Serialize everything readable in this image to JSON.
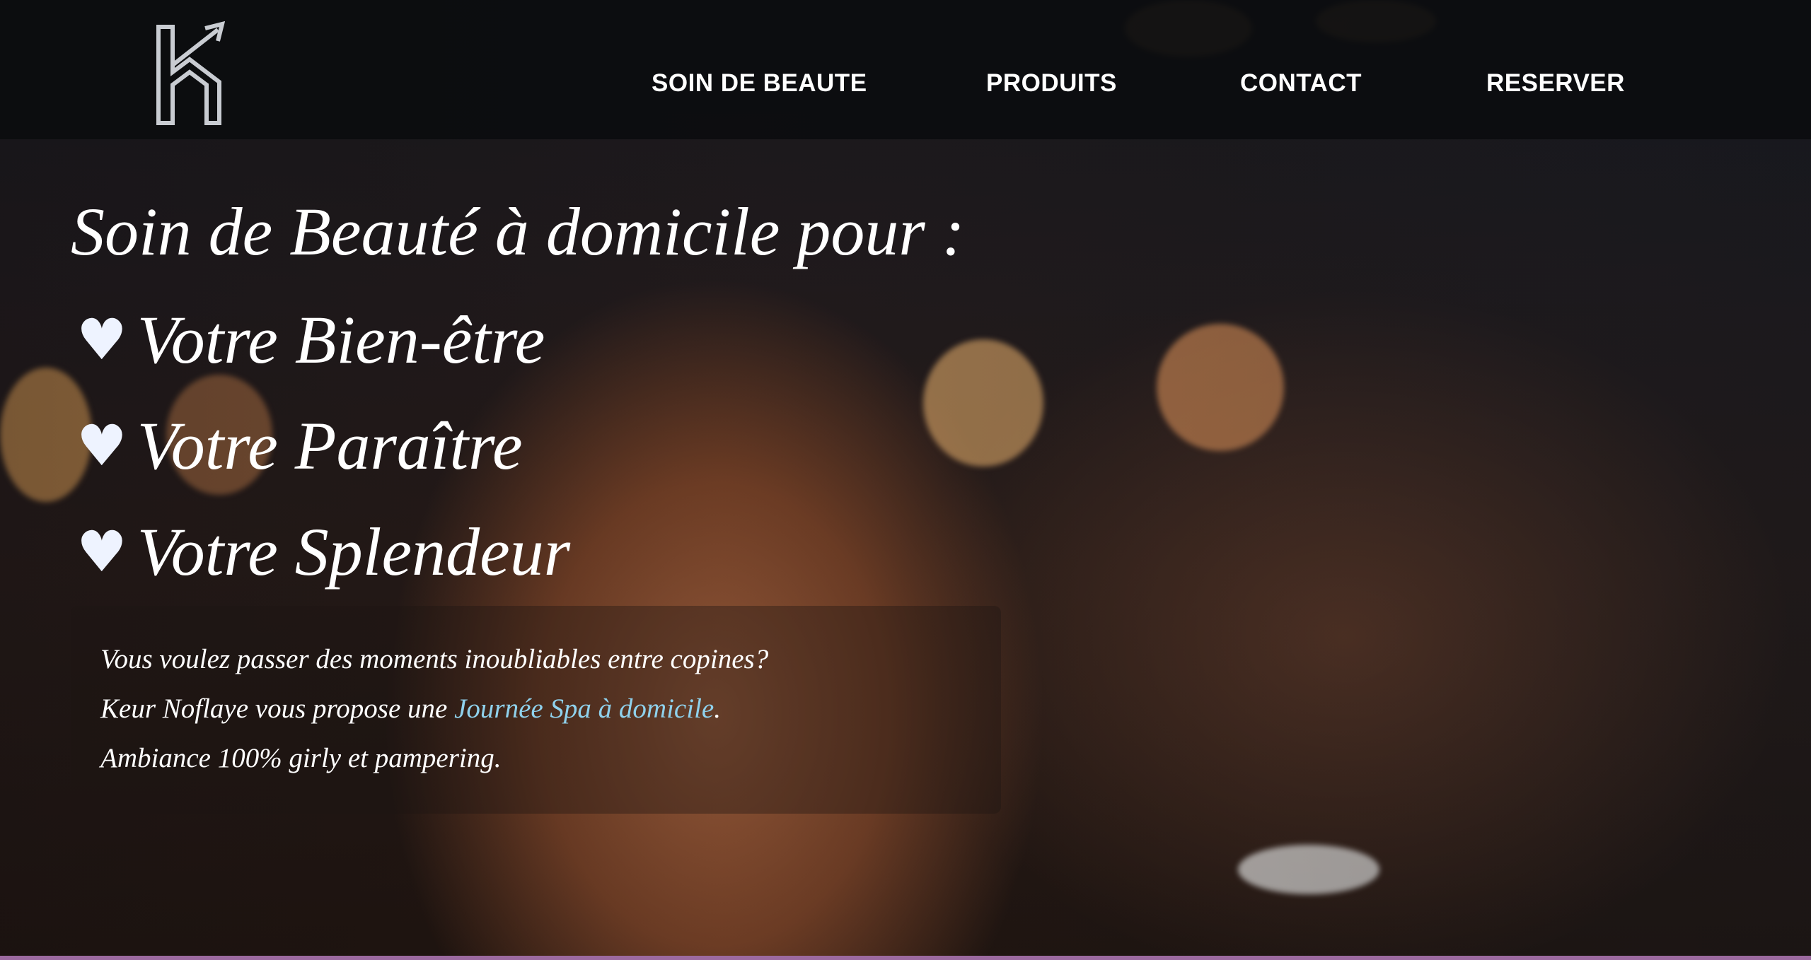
{
  "brand": {
    "logo_icon": "house-arrow-logo-icon"
  },
  "nav": {
    "items": [
      {
        "label": "SOIN DE BEAUTE"
      },
      {
        "label": "PRODUITS"
      },
      {
        "label": "CONTACT"
      },
      {
        "label": "RESERVER"
      }
    ]
  },
  "hero": {
    "title": "Soin de Beauté à domicile pour :",
    "benefits": [
      {
        "icon": "heart-icon",
        "glyph": "♥",
        "label": "Votre Bien-être"
      },
      {
        "icon": "heart-icon",
        "glyph": "♥",
        "label": "Votre Paraître"
      },
      {
        "icon": "heart-icon",
        "glyph": "♥",
        "label": "Votre Splendeur"
      }
    ]
  },
  "info": {
    "line1": "Vous voulez passer des moments inoubliables entre copines?",
    "line2_prefix": "Keur Noflaye vous propose une ",
    "line2_link": "Journée Spa à domicile",
    "line2_suffix": ".",
    "line3": "Ambiance 100% girly et pampering."
  },
  "colors": {
    "nav_bg": "#0a0c0e",
    "text": "#ffffff",
    "link": "#8fd1ec",
    "bottom_accent": "#9c6aa0"
  }
}
